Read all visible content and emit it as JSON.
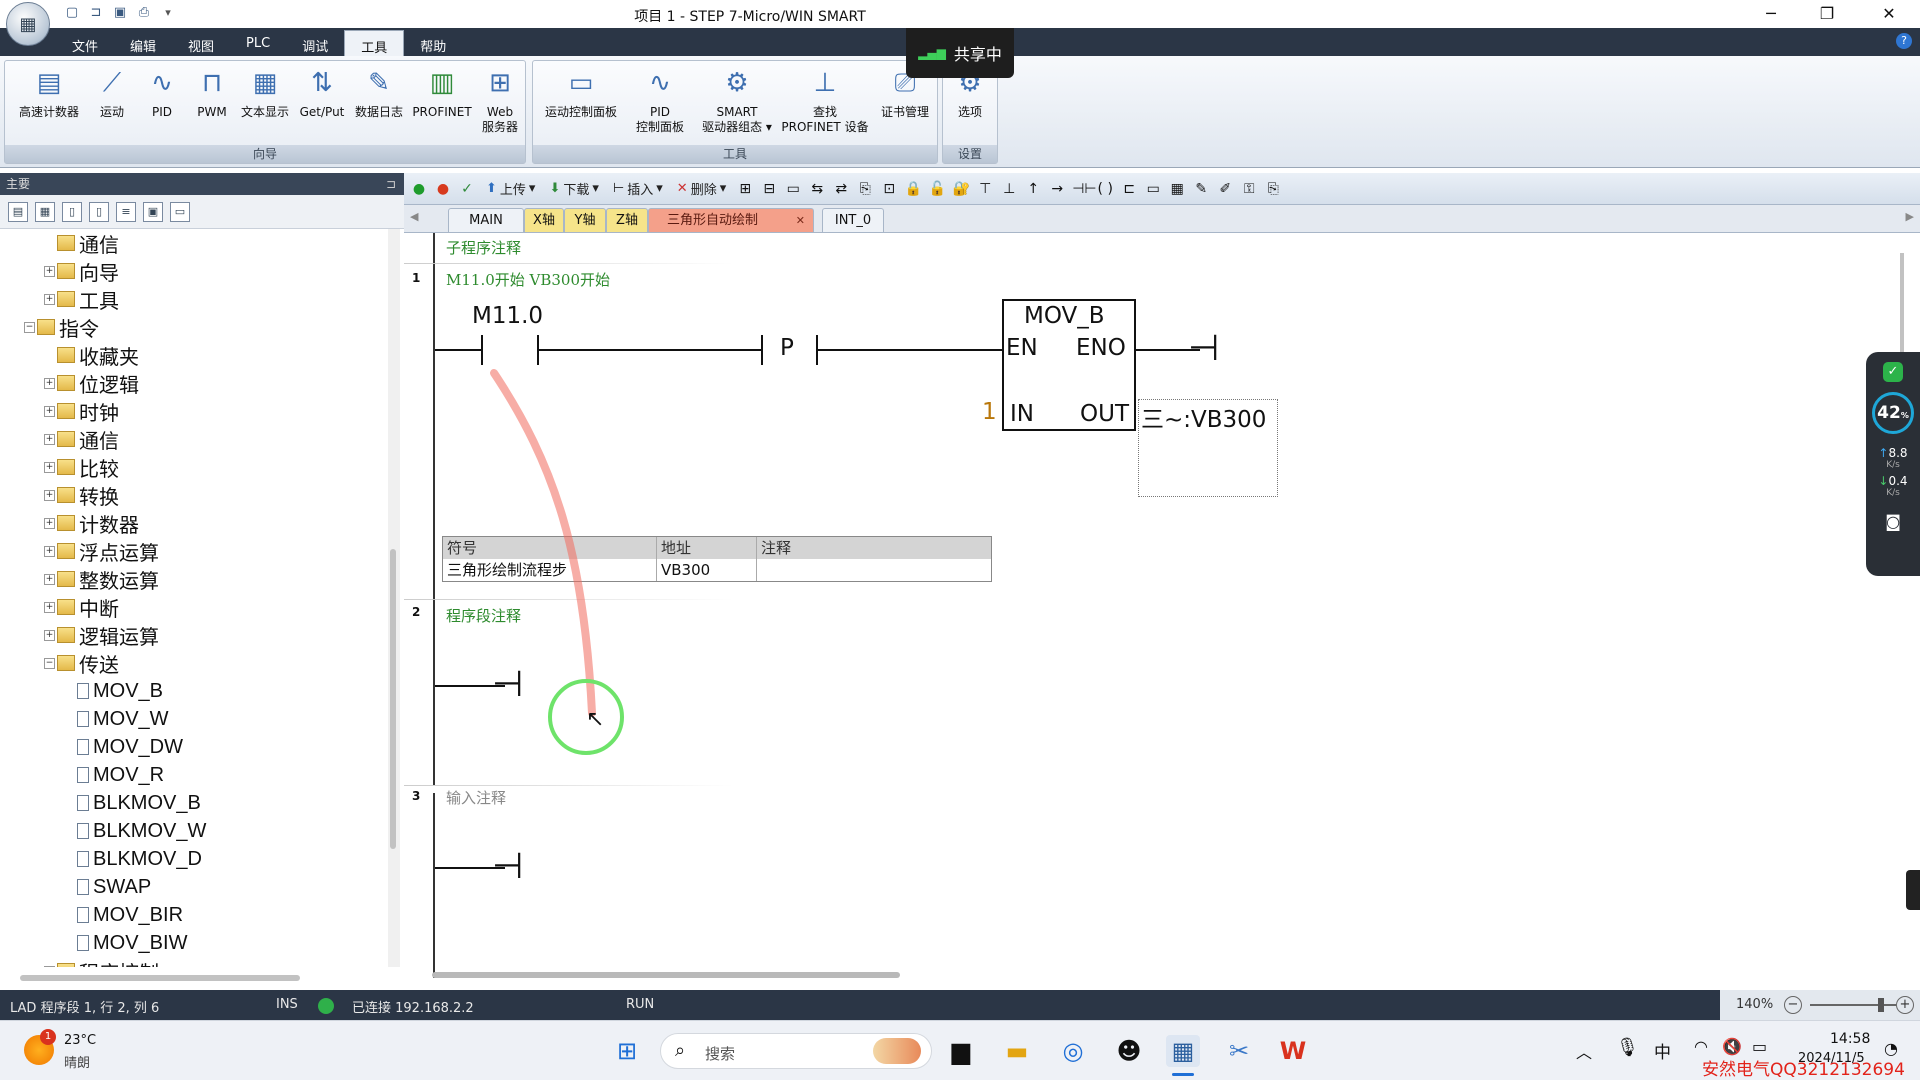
{
  "window": {
    "title": "项目 1 - STEP 7-Micro/WIN SMART",
    "minimize": "─",
    "restore": "❐",
    "close": "✕",
    "qat_icons": [
      "new-file-icon",
      "open-folder-icon",
      "save-icon",
      "print-icon"
    ],
    "qat_dropdown": "▾"
  },
  "menu": {
    "tabs": [
      "文件",
      "编辑",
      "视图",
      "PLC",
      "调试",
      "工具",
      "帮助"
    ],
    "active": "工具",
    "help": "?"
  },
  "share_badge": "共享中",
  "ribbon": {
    "groups": [
      {
        "label": "向导",
        "buttons": [
          "高速计数器",
          "运动",
          "PID",
          "PWM",
          "文本显示",
          "Get/Put",
          "数据日志",
          "PROFINET",
          "Web服务器"
        ]
      },
      {
        "label": "工具",
        "buttons": [
          "运动控制面板",
          "PID控制面板",
          "SMART驱动器组态",
          "查找PROFINET 设备",
          "证书管理"
        ]
      },
      {
        "label": "设置",
        "buttons": [
          "选项"
        ]
      }
    ],
    "btn_lines": {
      "web": [
        "Web",
        "服务器"
      ],
      "pid2": [
        "PID",
        "控制面板"
      ],
      "smart": [
        "SMART",
        "驱动器组态 ▾"
      ],
      "find": [
        "查找",
        "PROFINET 设备"
      ]
    }
  },
  "left_panel": {
    "title": "主要",
    "pin": "⊐",
    "tree": [
      {
        "label": "通信",
        "level": 1,
        "expand": "",
        "icon": "monitor-icon"
      },
      {
        "label": "向导",
        "level": 1,
        "expand": "+",
        "icon": "wizard-icon"
      },
      {
        "label": "工具",
        "level": 1,
        "expand": "+",
        "icon": "tools-icon"
      },
      {
        "label": "指令",
        "level": 0,
        "expand": "−",
        "icon": "instructions-folder-icon"
      },
      {
        "label": "收藏夹",
        "level": 1,
        "expand": "",
        "icon": "favorites-folder-icon"
      },
      {
        "label": "位逻辑",
        "level": 1,
        "expand": "+",
        "icon": "folder-icon"
      },
      {
        "label": "时钟",
        "level": 1,
        "expand": "+",
        "icon": "folder-icon"
      },
      {
        "label": "通信",
        "level": 1,
        "expand": "+",
        "icon": "folder-icon"
      },
      {
        "label": "比较",
        "level": 1,
        "expand": "+",
        "icon": "folder-icon"
      },
      {
        "label": "转换",
        "level": 1,
        "expand": "+",
        "icon": "folder-icon"
      },
      {
        "label": "计数器",
        "level": 1,
        "expand": "+",
        "icon": "folder-icon"
      },
      {
        "label": "浮点运算",
        "level": 1,
        "expand": "+",
        "icon": "folder-icon"
      },
      {
        "label": "整数运算",
        "level": 1,
        "expand": "+",
        "icon": "folder-icon"
      },
      {
        "label": "中断",
        "level": 1,
        "expand": "+",
        "icon": "folder-icon"
      },
      {
        "label": "逻辑运算",
        "level": 1,
        "expand": "+",
        "icon": "folder-icon"
      },
      {
        "label": "传送",
        "level": 1,
        "expand": "−",
        "icon": "folder-open-icon"
      },
      {
        "label": "MOV_B",
        "level": 2,
        "expand": "",
        "icon": "instruction-icon"
      },
      {
        "label": "MOV_W",
        "level": 2,
        "expand": "",
        "icon": "instruction-icon"
      },
      {
        "label": "MOV_DW",
        "level": 2,
        "expand": "",
        "icon": "instruction-icon"
      },
      {
        "label": "MOV_R",
        "level": 2,
        "expand": "",
        "icon": "instruction-icon"
      },
      {
        "label": "BLKMOV_B",
        "level": 2,
        "expand": "",
        "icon": "instruction-icon"
      },
      {
        "label": "BLKMOV_W",
        "level": 2,
        "expand": "",
        "icon": "instruction-icon"
      },
      {
        "label": "BLKMOV_D",
        "level": 2,
        "expand": "",
        "icon": "instruction-icon"
      },
      {
        "label": "SWAP",
        "level": 2,
        "expand": "",
        "icon": "instruction-icon"
      },
      {
        "label": "MOV_BIR",
        "level": 2,
        "expand": "",
        "icon": "instruction-icon"
      },
      {
        "label": "MOV_BIW",
        "level": 2,
        "expand": "",
        "icon": "instruction-icon"
      },
      {
        "label": "程序控制",
        "level": 1,
        "expand": "+",
        "icon": "folder-icon"
      }
    ]
  },
  "editor_toolbar": {
    "upload": "上传",
    "download": "下载",
    "insert": "插入",
    "delete": "删除",
    "dropdown": "▾"
  },
  "editor_tabs": [
    {
      "label": "MAIN",
      "style": "normal"
    },
    {
      "label": "X轴",
      "style": "y"
    },
    {
      "label": "Y轴",
      "style": "y"
    },
    {
      "label": "Z轴",
      "style": "y"
    },
    {
      "label": "三角形自动绘制",
      "style": "active"
    },
    {
      "label": "INT_0",
      "style": "normal"
    }
  ],
  "tab_close": "✕",
  "ladder": {
    "subroutine_comment": "子程序注释",
    "rungs": [
      {
        "number": "1",
        "comment": "M11.0开始  VB300开始"
      },
      {
        "number": "2",
        "comment": "程序段注释"
      },
      {
        "number": "3",
        "comment": "输入注释"
      }
    ],
    "contact_label": "M11.0",
    "p_label": "P",
    "box": {
      "title": "MOV_B",
      "en": "EN",
      "eno": "ENO",
      "in": "IN",
      "out": "OUT",
      "in_value": "1",
      "out_value": "三~:VB300"
    },
    "symbol_table": {
      "headers": [
        "符号",
        "地址",
        "注释"
      ],
      "row": [
        "三角形绘制流程步",
        "VB300",
        ""
      ]
    }
  },
  "status": {
    "position": "LAD 程序段 1, 行 2, 列 6",
    "mode": "INS",
    "connection": "已连接 192.168.2.2",
    "run": "RUN",
    "zoom": "140%",
    "zoom_out": "−",
    "zoom_in": "+"
  },
  "net_widget": {
    "percent": "42",
    "percent_unit": "%",
    "up": "8.8",
    "down": "0.4",
    "unit": "K/s",
    "up_arrow": "↑",
    "down_arrow": "↓"
  },
  "taskbar": {
    "weather_temp": "23°C",
    "weather_desc": "晴朗",
    "weather_badge": "1",
    "search": "搜索",
    "clock_time": "14:58",
    "clock_date": "2024/11/5",
    "ime": "中",
    "chevron": "︿"
  },
  "watermark": "安然电气QQ3212132694",
  "colors": {
    "accent": "#2b3646",
    "comment_green": "#2e8b2e",
    "active_tab": "#f4a08a",
    "axis_tab": "#f6e48a"
  }
}
